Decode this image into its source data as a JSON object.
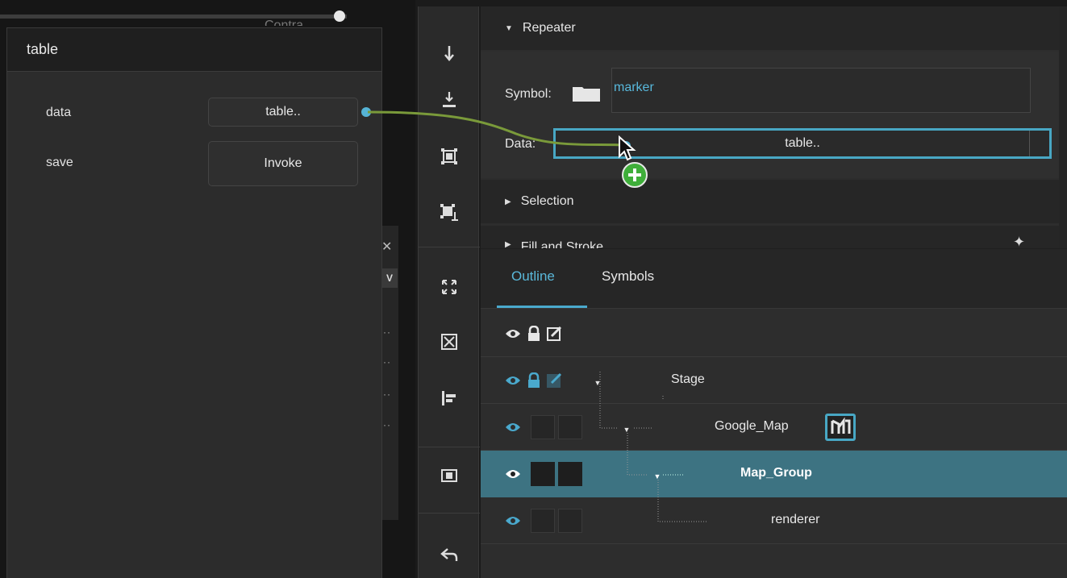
{
  "background": {
    "contra_text": "Contra"
  },
  "table_node": {
    "title": "table",
    "rows": [
      {
        "label": "data",
        "button": "table.."
      },
      {
        "label": "save",
        "button": "Invoke"
      }
    ]
  },
  "properties": {
    "repeater": {
      "header": "Repeater",
      "symbol_label": "Symbol:",
      "symbol_value": "marker",
      "data_label": "Data:",
      "data_value": "table.."
    },
    "selection_header": "Selection",
    "fill_stroke_header": "Fill and Stroke"
  },
  "outline": {
    "tabs": {
      "outline": "Outline",
      "symbols": "Symbols"
    },
    "items": [
      {
        "name": "Stage"
      },
      {
        "name": "Google_Map"
      },
      {
        "name": "Map_Group"
      },
      {
        "name": "renderer"
      }
    ]
  },
  "colors": {
    "accent": "#48a7c4",
    "link_wire": "#7a9a3a",
    "add_badge": "#3fae3a",
    "selected_row": "#3d7382"
  },
  "icons": {
    "toolbar": [
      "arrow-down-icon",
      "send-to-back-icon",
      "frame-icon",
      "frame-resize-icon",
      "expand-icon",
      "fit-icon",
      "align-left-icon",
      "fill-window-icon",
      "undo-icon"
    ],
    "drag": [
      "cursor-icon",
      "add-icon"
    ]
  }
}
